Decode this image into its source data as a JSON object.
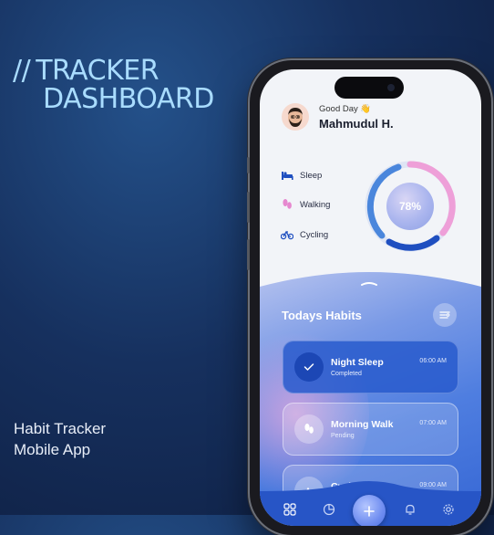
{
  "hero": {
    "slashes": "//",
    "title_line1": "TRACKER",
    "title_line2": "DASHBOARD",
    "subtitle_line1": "Habit Tracker",
    "subtitle_line2": "Mobile App"
  },
  "header": {
    "greeting": "Good Day 👋",
    "user_name": "Mahmudul H."
  },
  "metrics": [
    {
      "label": "Sleep",
      "icon": "bed-icon"
    },
    {
      "label": "Walking",
      "icon": "footprints-icon"
    },
    {
      "label": "Cycling",
      "icon": "bicycle-icon"
    }
  ],
  "progress": {
    "value": 0.78,
    "label": "78%"
  },
  "habits": {
    "title": "Todays Habits",
    "items": [
      {
        "name": "Night Sleep",
        "status": "Completed",
        "time": "06:00 AM",
        "icon": "check-icon"
      },
      {
        "name": "Morning Walk",
        "status": "Pending",
        "time": "07:00 AM",
        "icon": "footprints-icon"
      },
      {
        "name": "Cycling",
        "status": "",
        "time": "09:00 AM",
        "icon": "bicycle-icon"
      }
    ]
  },
  "nav": {
    "items": [
      "grid-icon",
      "chart-icon",
      "plus-icon",
      "bell-icon",
      "gear-icon"
    ]
  },
  "colors": {
    "accent": "#3566d4",
    "ring_blue": "#1f4fc0",
    "ring_pink": "#ee9fd8",
    "heading": "#a9dcff"
  }
}
